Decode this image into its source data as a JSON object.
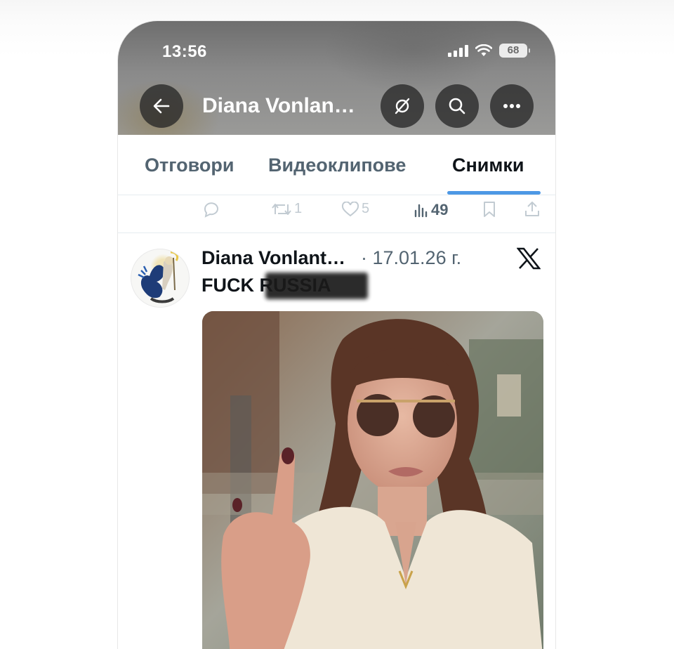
{
  "status_bar": {
    "time": "13:56",
    "battery": "68"
  },
  "header": {
    "title": "Diana Vonlan…"
  },
  "tabs": [
    {
      "label": "Отговори"
    },
    {
      "label": "Видеоклипове"
    },
    {
      "label": "Снимки"
    }
  ],
  "previous_tweet_actions": {
    "retweets": "1",
    "likes": "5",
    "views": "49"
  },
  "tweet": {
    "author": "Diana Vonlant…",
    "date": "· 17.01.26 г.",
    "text": "FUCK RUSSIA"
  },
  "colors": {
    "accent": "#4d98e5",
    "text_primary": "#0f1419",
    "text_secondary": "#536471"
  }
}
